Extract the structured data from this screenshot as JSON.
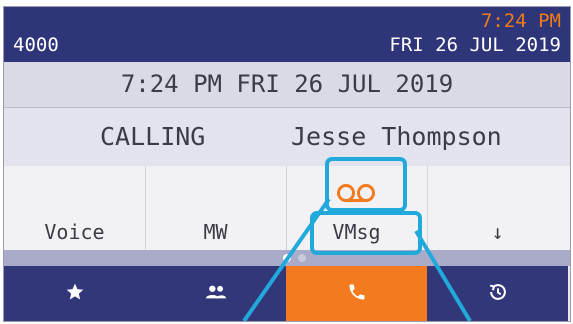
{
  "topbar": {
    "extension": "4000",
    "time": "7:24 PM",
    "date": "FRI 26 JUL 2019"
  },
  "status": {
    "datetime_text": "7:24 PM FRI 26 JUL 2019"
  },
  "call": {
    "state": "CALLING",
    "caller_name": "Jesse Thompson"
  },
  "softkeys": [
    {
      "label": "Voice"
    },
    {
      "label": "MW"
    },
    {
      "label": "VMsg",
      "icon": "voicemail-icon"
    },
    {
      "label": "↓"
    }
  ],
  "pager": {
    "page_count": 2,
    "current_page": 1
  },
  "navbar": [
    {
      "icon": "star-icon"
    },
    {
      "icon": "contacts-icon"
    },
    {
      "icon": "phone-icon",
      "active": true
    },
    {
      "icon": "history-icon"
    }
  ],
  "colors": {
    "topbar_bg": "#2f3579",
    "time_accent": "#f07a1a",
    "active_tab": "#f47a1f",
    "highlight": "#22a9dc"
  }
}
